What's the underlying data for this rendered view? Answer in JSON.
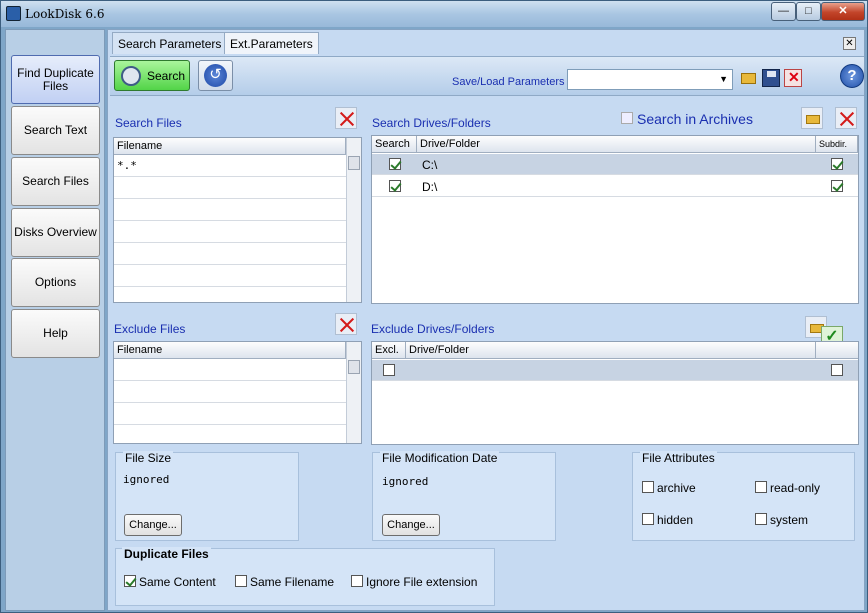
{
  "window": {
    "title": "LookDisk 6.6"
  },
  "nav": {
    "items": [
      {
        "label": "Find Duplicate Files"
      },
      {
        "label": "Search Text"
      },
      {
        "label": "Search Files"
      },
      {
        "label": "Disks Overview"
      },
      {
        "label": "Options"
      },
      {
        "label": "Help"
      }
    ]
  },
  "tabs": [
    {
      "label": "Search Parameters"
    },
    {
      "label": "Ext.Parameters"
    }
  ],
  "toolbar": {
    "search_label": "Search",
    "saveload_label": "Save/Load Parameters",
    "saveload_value": ""
  },
  "search_files": {
    "title": "Search Files",
    "column": "Filename",
    "rows": [
      "*.*"
    ]
  },
  "search_drives": {
    "title": "Search Drives/Folders",
    "archives_label": "Search in Archives",
    "archives_checked": false,
    "columns": [
      "Search",
      "Drive/Folder",
      "Subdir."
    ],
    "rows": [
      {
        "path": "C:\\",
        "search": true,
        "subdir": true
      },
      {
        "path": "D:\\",
        "search": true,
        "subdir": true
      }
    ]
  },
  "exclude_files": {
    "title": "Exclude Files",
    "column": "Filename"
  },
  "exclude_drives": {
    "title": "Exclude Drives/Folders",
    "columns": [
      "Excl.",
      "Drive/Folder"
    ]
  },
  "file_size": {
    "title": "File Size",
    "value": "ignored",
    "button": "Change..."
  },
  "file_date": {
    "title": "File Modification Date",
    "value": "ignored",
    "button": "Change..."
  },
  "file_attributes": {
    "title": "File Attributes",
    "items": [
      "archive",
      "read-only",
      "hidden",
      "system"
    ]
  },
  "duplicate_files": {
    "title": "Duplicate Files",
    "options": [
      {
        "label": "Same Content",
        "checked": true
      },
      {
        "label": "Same Filename",
        "checked": false
      },
      {
        "label": "Ignore File extension",
        "checked": false
      }
    ]
  }
}
